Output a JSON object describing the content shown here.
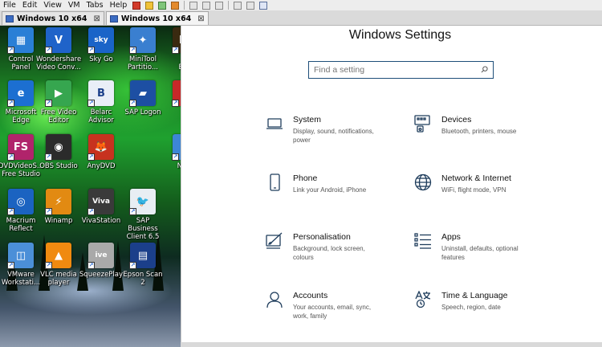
{
  "menubar": {
    "items": [
      "File",
      "Edit",
      "View",
      "VM",
      "Tabs",
      "Help"
    ]
  },
  "tabs": [
    {
      "label": "Windows 10 x64",
      "close": "⊠"
    },
    {
      "label": "Windows 10 x64",
      "close": "⊠"
    }
  ],
  "desktop": {
    "icons": [
      {
        "label": "Control Panel",
        "icon": "control-panel-icon",
        "color": "#2a7fd6",
        "glyph": "▦"
      },
      {
        "label": "Wondershare\nVideo Conv...",
        "icon": "wondershare-icon",
        "color": "#1f63c9",
        "glyph": "V"
      },
      {
        "label": "Sky Go",
        "icon": "sky-go-icon",
        "color": "#1a64c8",
        "glyph": "sky"
      },
      {
        "label": "MiniTool\nPartitio...",
        "icon": "minitool-icon",
        "color": "#3a7fd0",
        "glyph": "✦"
      },
      {
        "label": "Microsoft\nEdge",
        "icon": "edge-icon",
        "color": "#1c6fd1",
        "glyph": "e"
      },
      {
        "label": "Free Video\nEditor",
        "icon": "free-video-editor-icon",
        "color": "#36a64f",
        "glyph": "▶"
      },
      {
        "label": "Belarc\nAdvisor",
        "icon": "belarc-icon",
        "color": "#e9eef7",
        "glyph": "B"
      },
      {
        "label": "SAP Logon",
        "icon": "sap-logon-icon",
        "color": "#1d4fa3",
        "glyph": "▰"
      },
      {
        "label": "DVDVideoS...\nFree Studio",
        "icon": "dvdvideosoft-icon",
        "color": "#b0246b",
        "glyph": "FS"
      },
      {
        "label": "OBS Studio",
        "icon": "obs-icon",
        "color": "#2b2b2b",
        "glyph": "◉"
      },
      {
        "label": "AnyDVD",
        "icon": "anydvd-icon",
        "color": "#c7321f",
        "glyph": "🦊"
      },
      {
        "label": "Macrium\nReflect",
        "icon": "macrium-icon",
        "color": "#1b63c1",
        "glyph": "◎"
      },
      {
        "label": "Winamp",
        "icon": "winamp-icon",
        "color": "#e28a12",
        "glyph": "⚡"
      },
      {
        "label": "VivaStation",
        "icon": "vivastation-icon",
        "color": "#3a3a3a",
        "glyph": "Viva"
      },
      {
        "label": "SAP Business\nClient 6.5",
        "icon": "sap-business-client-icon",
        "color": "#e8eef3",
        "glyph": "🐦"
      },
      {
        "label": "VMware\nWorkstati...",
        "icon": "vmware-icon",
        "color": "#4b8fd8",
        "glyph": "◫"
      },
      {
        "label": "VLC media\nplayer",
        "icon": "vlc-icon",
        "color": "#f08a10",
        "glyph": "▲"
      },
      {
        "label": "SqueezePlay",
        "icon": "squeezeplay-icon",
        "color": "#a9a9a9",
        "glyph": "ive"
      },
      {
        "label": "Epson Scan 2",
        "icon": "epson-scan-icon",
        "color": "#1b3f8a",
        "glyph": "▤"
      },
      {
        "label": "Ad\nBrid",
        "icon": "adobe-bridge-icon",
        "color": "#3a2a10",
        "glyph": "Br"
      },
      {
        "label": "",
        "icon": "partial-red-icon",
        "color": "#c72929",
        "glyph": "F"
      },
      {
        "label": "Net -",
        "icon": "network-icon",
        "color": "#3d86d6",
        "glyph": "⊞"
      }
    ]
  },
  "settings": {
    "title": "Windows Settings",
    "search_placeholder": "Find a setting",
    "tiles": [
      {
        "title": "System",
        "desc": "Display, sound, notifications,\npower",
        "icon": "laptop-icon"
      },
      {
        "title": "Devices",
        "desc": "Bluetooth, printers, mouse",
        "icon": "devices-icon"
      },
      {
        "title": "Phone",
        "desc": "Link your Android, iPhone",
        "icon": "phone-icon"
      },
      {
        "title": "Network & Internet",
        "desc": "WiFi, flight mode, VPN",
        "icon": "globe-icon"
      },
      {
        "title": "Personalisation",
        "desc": "Background, lock screen,\ncolours",
        "icon": "personalisation-icon"
      },
      {
        "title": "Apps",
        "desc": "Uninstall, defaults, optional\nfeatures",
        "icon": "apps-list-icon"
      },
      {
        "title": "Accounts",
        "desc": "Your accounts, email, sync,\nwork, family",
        "icon": "person-icon"
      },
      {
        "title": "Time & Language",
        "desc": "Speech, region, date",
        "icon": "time-language-icon"
      }
    ]
  },
  "colors": {
    "settings_icon_stroke": "#1f3d5c",
    "search_border": "#1e4e79"
  }
}
